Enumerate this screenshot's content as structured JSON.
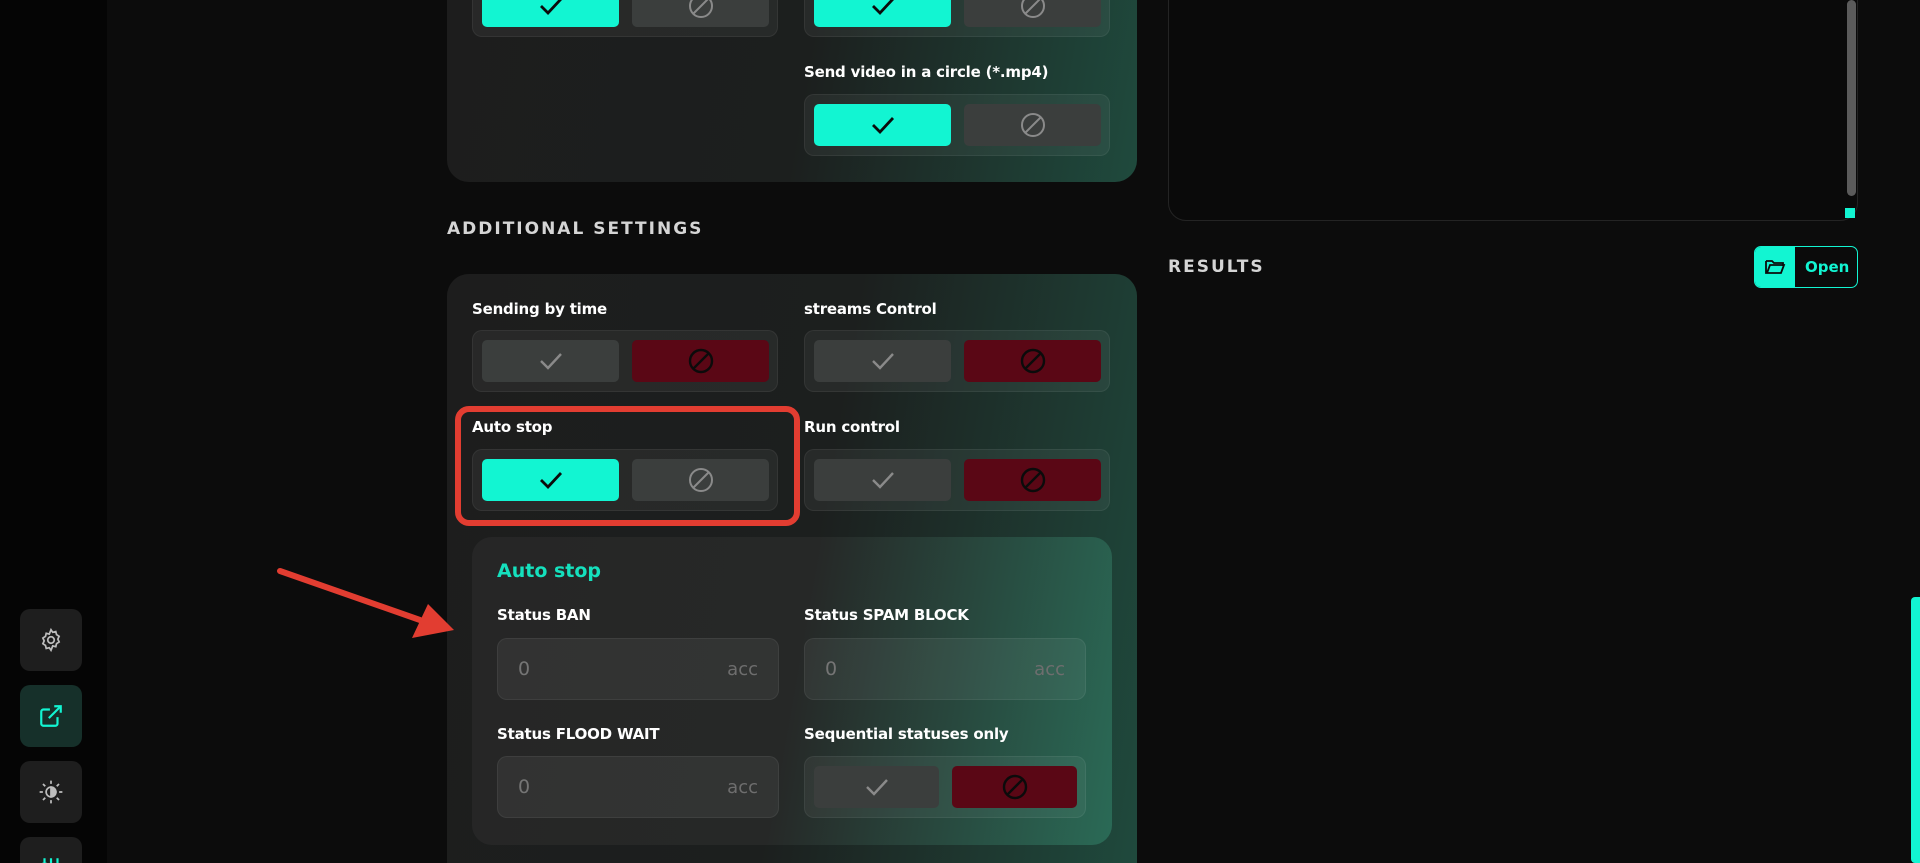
{
  "sidebar": {
    "items": [
      {
        "name": "settings",
        "icon": "gear-icon"
      },
      {
        "name": "export",
        "icon": "external-link-icon",
        "active": true
      },
      {
        "name": "theme",
        "icon": "sun-moon-icon"
      },
      {
        "name": "adjust",
        "icon": "sliders-icon"
      }
    ]
  },
  "media_group": {
    "send_video_label": "Send video in a circle (*.mp4)"
  },
  "additional_settings": {
    "title": "ADDITIONAL SETTINGS",
    "sending_by_time": {
      "label": "Sending by time",
      "value": "off"
    },
    "streams_control": {
      "label": "streams Control",
      "value": "off"
    },
    "auto_stop": {
      "label": "Auto stop",
      "value": "on"
    },
    "run_control": {
      "label": "Run control",
      "value": "off"
    }
  },
  "auto_stop_panel": {
    "title": "Auto stop",
    "status_ban": {
      "label": "Status BAN",
      "placeholder": "0",
      "unit": "acc"
    },
    "status_spam_block": {
      "label": "Status SPAM BLOCK",
      "placeholder": "0",
      "unit": "acc"
    },
    "status_flood_wait": {
      "label": "Status FLOOD WAIT",
      "placeholder": "0",
      "unit": "acc"
    },
    "sequential_statuses": {
      "label": "Sequential statuses only",
      "value": "off"
    }
  },
  "results": {
    "title": "RESULTS",
    "open_label": "Open"
  },
  "colors": {
    "accent": "#12f5d2",
    "danger": "#5a0715",
    "highlight": "#e23d31"
  }
}
